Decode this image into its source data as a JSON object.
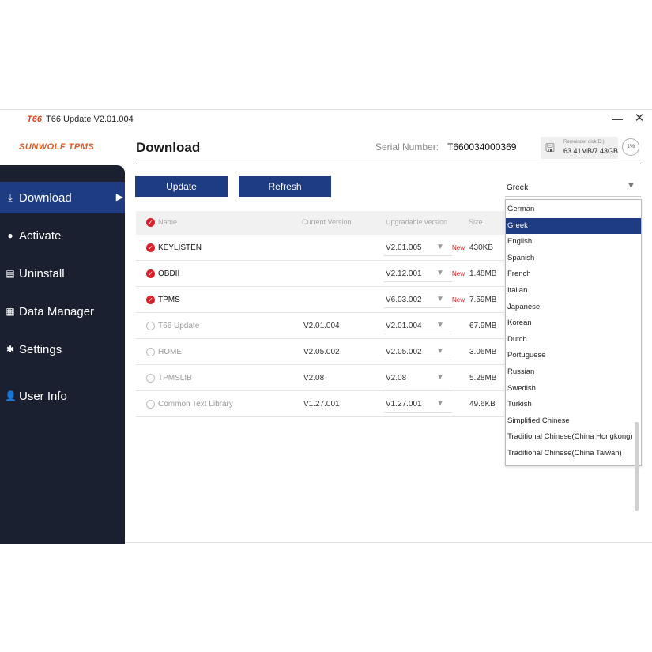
{
  "window": {
    "logo_mark": "T66",
    "title": "T66 Update  V2.01.004",
    "minimize": "—",
    "close": "✕"
  },
  "brand": {
    "logo_text": "SUNWOLF TPMS"
  },
  "sidebar": {
    "items": [
      {
        "label": "Download",
        "icon": "download-icon",
        "active": true
      },
      {
        "label": "Activate",
        "icon": "bulb-icon"
      },
      {
        "label": "Uninstall",
        "icon": "trash-icon"
      },
      {
        "label": "Data Manager",
        "icon": "clipboard-icon"
      },
      {
        "label": "Settings",
        "icon": "gear-icon"
      },
      {
        "label": "User Info",
        "icon": "user-icon"
      }
    ]
  },
  "header": {
    "page_title": "Download",
    "serial_label": "Serial Number:",
    "serial_value": "T660034000369",
    "storage_label": "Remainder disk(D:)",
    "storage_value": "63.41MB/7.43GB",
    "zoom": "1%"
  },
  "toolbar": {
    "update_label": "Update",
    "refresh_label": "Refresh"
  },
  "table": {
    "columns": [
      "Name",
      "Current Version",
      "Upgradable version",
      "Size"
    ],
    "rows": [
      {
        "name": "KEYLISTEN",
        "checked": true,
        "current": "",
        "upgrade": "V2.01.005",
        "new": "New",
        "size": "430KB"
      },
      {
        "name": "OBDII",
        "checked": true,
        "current": "",
        "upgrade": "V2.12.001",
        "new": "New",
        "size": "1.48MB"
      },
      {
        "name": "TPMS",
        "checked": true,
        "current": "",
        "upgrade": "V6.03.002",
        "new": "New",
        "size": "7.59MB"
      },
      {
        "name": "T66 Update",
        "checked": false,
        "current": "V2.01.004",
        "upgrade": "V2.01.004",
        "new": "",
        "size": "67.9MB"
      },
      {
        "name": "HOME",
        "checked": false,
        "current": "V2.05.002",
        "upgrade": "V2.05.002",
        "new": "",
        "size": "3.06MB"
      },
      {
        "name": "TPMSLIB",
        "checked": false,
        "current": "V2.08",
        "upgrade": "V2.08",
        "new": "",
        "size": "5.28MB"
      },
      {
        "name": "Common Text Library",
        "checked": false,
        "current": "V1.27.001",
        "upgrade": "V1.27.001",
        "new": "",
        "size": "49.6KB"
      }
    ]
  },
  "language": {
    "selected": "Greek",
    "options": [
      "German",
      "Greek",
      "English",
      "Spanish",
      "French",
      "Italian",
      "Japanese",
      "Korean",
      "Dutch",
      "Portuguese",
      "Russian",
      "Swedish",
      "Turkish",
      "Simplified Chinese",
      "Traditional Chinese(China Hongkong)",
      "Traditional Chinese(China Taiwan)"
    ]
  },
  "colors": {
    "accent": "#1e3c82",
    "sidebar": "#1a2030",
    "check": "#d8212a",
    "brand": "#e25a22"
  }
}
